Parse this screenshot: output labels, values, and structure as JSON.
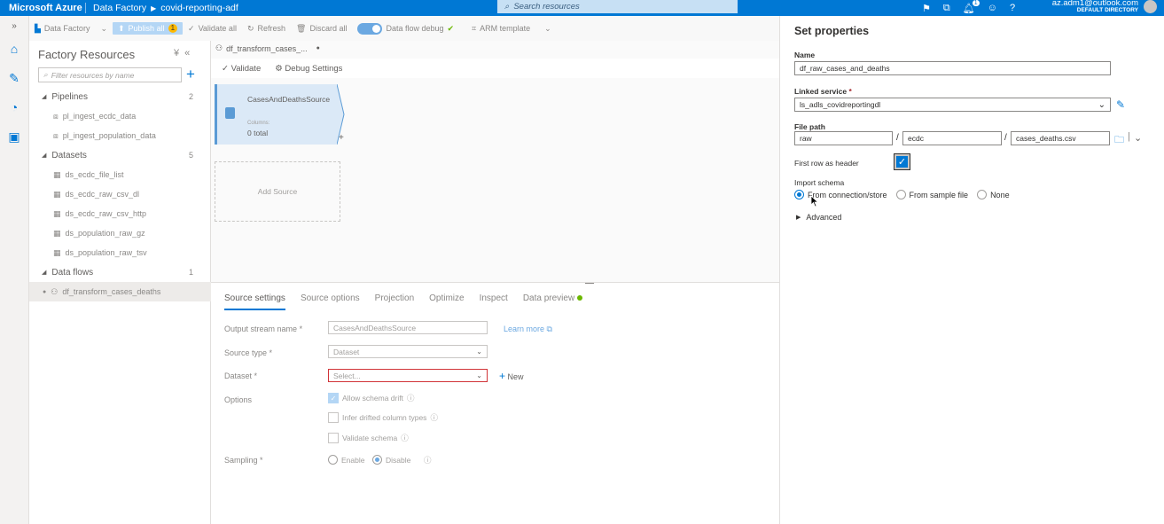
{
  "topbar": {
    "brand": "Microsoft Azure",
    "service": "Data Factory",
    "factory": "covid-reporting-adf",
    "search_placeholder": "Search resources",
    "account_email": "az.adm1@outlook.com",
    "account_directory": "DEFAULT DIRECTORY",
    "notification_count": "1"
  },
  "toolbar": {
    "data_factory": "Data Factory",
    "publish_all": "Publish all",
    "publish_count": "1",
    "validate_all": "Validate all",
    "refresh": "Refresh",
    "discard_all": "Discard all",
    "data_flow_debug": "Data flow debug",
    "arm_template": "ARM template"
  },
  "resources": {
    "title": "Factory Resources",
    "filter_placeholder": "Filter resources by name",
    "groups": [
      {
        "name": "Pipelines",
        "count": "2",
        "items": [
          "pl_ingest_ecdc_data",
          "pl_ingest_population_data"
        ]
      },
      {
        "name": "Datasets",
        "count": "5",
        "items": [
          "ds_ecdc_file_list",
          "ds_ecdc_raw_csv_dl",
          "ds_ecdc_raw_csv_http",
          "ds_population_raw_gz",
          "ds_population_raw_tsv"
        ]
      },
      {
        "name": "Data flows",
        "count": "1",
        "items": [
          "df_transform_cases_deaths"
        ]
      }
    ]
  },
  "canvas": {
    "tab": "df_transform_cases_...",
    "validate": "Validate",
    "debug_settings": "Debug Settings",
    "node_name": "CasesAndDeathsSource",
    "node_columns_label": "Columns:",
    "node_columns_value": "0 total",
    "add_source": "Add Source"
  },
  "settings": {
    "tabs": [
      "Source settings",
      "Source options",
      "Projection",
      "Optimize",
      "Inspect",
      "Data preview"
    ],
    "output_stream_label": "Output stream name",
    "output_stream_value": "CasesAndDeathsSource",
    "learn_more": "Learn more",
    "source_type_label": "Source type",
    "source_type_value": "Dataset",
    "dataset_label": "Dataset",
    "dataset_placeholder": "Select...",
    "new_label": "New",
    "options_label": "Options",
    "opt_allow_drift": "Allow schema drift",
    "opt_infer_types": "Infer drifted column types",
    "opt_validate_schema": "Validate schema",
    "sampling_label": "Sampling",
    "sampling_enable": "Enable",
    "sampling_disable": "Disable",
    "required_marker": "*"
  },
  "properties": {
    "title": "Set properties",
    "name_label": "Name",
    "name_value": "df_raw_cases_and_deaths",
    "linked_service_label": "Linked service",
    "linked_service_value": "ls_adls_covidreportingdl",
    "file_path_label": "File path",
    "file_path_container": "raw",
    "file_path_directory": "ecdc",
    "file_path_file": "cases_deaths.csv",
    "first_row_header_label": "First row as header",
    "import_schema_label": "Import schema",
    "import_from_connection": "From connection/store",
    "import_from_sample": "From sample file",
    "import_none": "None",
    "advanced": "Advanced"
  }
}
